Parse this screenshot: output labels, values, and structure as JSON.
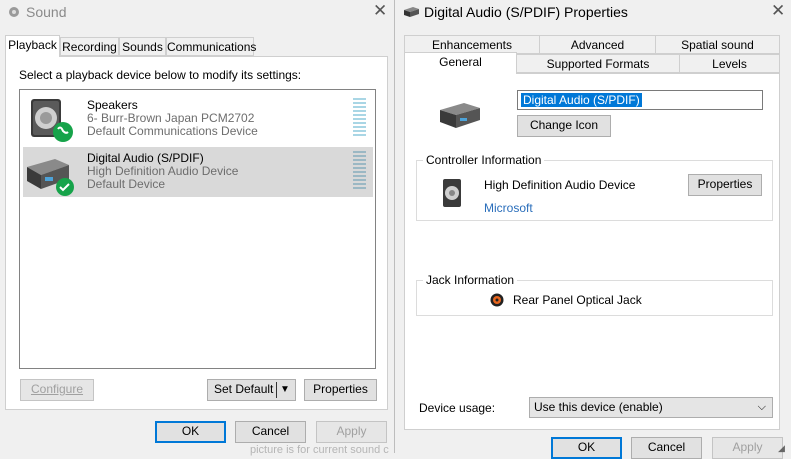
{
  "sound_window": {
    "title": "Sound",
    "tabs": [
      "Playback",
      "Recording",
      "Sounds",
      "Communications"
    ],
    "instruction": "Select a playback device below to modify its settings:",
    "devices": [
      {
        "name": "Speakers",
        "line1": "6- Burr-Brown Japan PCM2702",
        "line2": "Default Communications Device",
        "status_icon": "phone-check-icon"
      },
      {
        "name": "Digital Audio (S/PDIF)",
        "line1": "High Definition Audio Device",
        "line2": "Default Device",
        "status_icon": "checkmark-icon"
      }
    ],
    "buttons": {
      "configure": "Configure",
      "set_default": "Set Default",
      "properties": "Properties",
      "ok": "OK",
      "cancel": "Cancel",
      "apply": "Apply"
    }
  },
  "props_window": {
    "title": "Digital Audio (S/PDIF) Properties",
    "tabs_row1": [
      "Enhancements",
      "Advanced",
      "Spatial sound"
    ],
    "tabs_row2": [
      "General",
      "Supported Formats",
      "Levels"
    ],
    "device_name_value": "Digital Audio (S/PDIF)",
    "change_icon": "Change Icon",
    "controller": {
      "title": "Controller Information",
      "name": "High Definition Audio Device",
      "vendor": "Microsoft",
      "properties": "Properties"
    },
    "jack": {
      "title": "Jack Information",
      "name": "Rear Panel Optical Jack"
    },
    "device_usage_label": "Device usage:",
    "device_usage_value": "Use this device (enable)",
    "buttons": {
      "ok": "OK",
      "cancel": "Cancel",
      "apply": "Apply"
    }
  },
  "colors": {
    "accent": "#0078d7",
    "selection": "#d9d9d9",
    "status_green": "#16a34a"
  },
  "background_fragment": "picture is for current sound c"
}
